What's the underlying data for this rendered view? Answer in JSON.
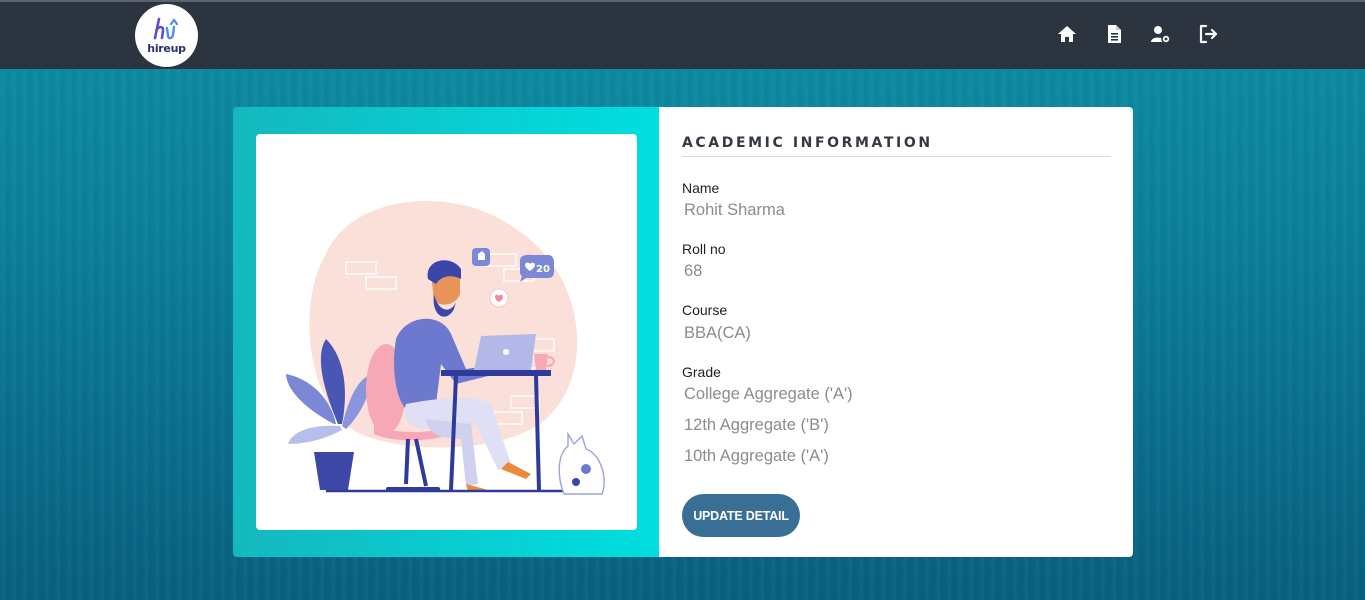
{
  "brand": {
    "name": "hireup"
  },
  "nav": {
    "icons": [
      "home-icon",
      "document-icon",
      "user-settings-icon",
      "logout-icon"
    ]
  },
  "profile": {
    "heading": "ACADEMIC INFORMATION",
    "name_label": "Name",
    "name_value": "Rohit Sharma",
    "roll_label": "Roll no",
    "roll_value": "68",
    "course_label": "Course",
    "course_value": "BBA(CA)",
    "grade_label": "Grade",
    "grades": [
      "College Aggregate ('A')",
      "12th Aggregate ('B')",
      "10th Aggregate ('A')"
    ],
    "update_button": "UPDATE DETAIL"
  },
  "illustration": {
    "likes_badge": "20"
  },
  "colors": {
    "navbar": "#2c3440",
    "card_left_start": "#14b8be",
    "card_left_end": "#00dfe0",
    "button": "#3a6f95",
    "value_text": "#8c8c8c"
  }
}
